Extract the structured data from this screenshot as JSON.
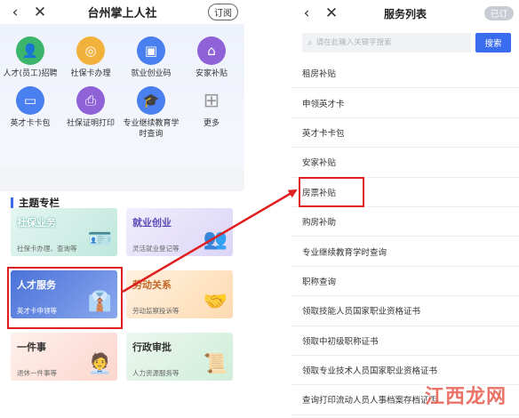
{
  "left": {
    "title": "台州掌上人社",
    "subscribe_label": "订阅",
    "services": [
      {
        "label": "人才(员工)招聘",
        "icon": "person-icon",
        "glyph": "👤",
        "color": "green"
      },
      {
        "label": "社保卡办理",
        "icon": "card-icon",
        "glyph": "◎",
        "color": "yellow"
      },
      {
        "label": "就业创业码",
        "icon": "qr-scan-icon",
        "glyph": "▣",
        "color": "blue"
      },
      {
        "label": "安家补贴",
        "icon": "home-icon",
        "glyph": "⌂",
        "color": "purple"
      },
      {
        "label": "英才卡卡包",
        "icon": "wallet-icon",
        "glyph": "▭",
        "color": "blue"
      },
      {
        "label": "社保证明打印",
        "icon": "printer-icon",
        "glyph": "⎙",
        "color": "purple"
      },
      {
        "label": "专业继续教育学时查询",
        "icon": "graduation-cap-icon",
        "glyph": "🎓",
        "color": "blue"
      },
      {
        "label": "更多",
        "icon": "grid-more-icon",
        "glyph": "⊞",
        "color": "grey"
      }
    ],
    "topic_title": "主题专栏",
    "cards": [
      {
        "title": "社保业务",
        "subtitle": "社保卡办理、查询等"
      },
      {
        "title": "就业创业",
        "subtitle": "灵活就业登记等"
      },
      {
        "title": "人才服务",
        "subtitle": "英才卡申领等"
      },
      {
        "title": "劳动关系",
        "subtitle": "劳动监察投诉等"
      },
      {
        "title": "一件事",
        "subtitle": "退休一件事等"
      },
      {
        "title": "行政审批",
        "subtitle": "人力资源服务等"
      }
    ]
  },
  "right": {
    "title": "服务列表",
    "subscribed_label": "已订",
    "search": {
      "placeholder": "请在此输入关键字搜索",
      "button": "搜索"
    },
    "items": [
      "租房补贴",
      "申领英才卡",
      "英才卡卡包",
      "安家补贴",
      "房票补贴",
      "购房补助",
      "专业继续教育学时查询",
      "职称查询",
      "领取技能人员国家职业资格证书",
      "领取中初级职称证书",
      "领取专业技术人员国家职业资格证书",
      "查询打印流动人员人事档案存档证明"
    ]
  },
  "watermark": "江西龙网",
  "colors": {
    "accent": "#3a6cf0",
    "highlight": "#e02020"
  }
}
